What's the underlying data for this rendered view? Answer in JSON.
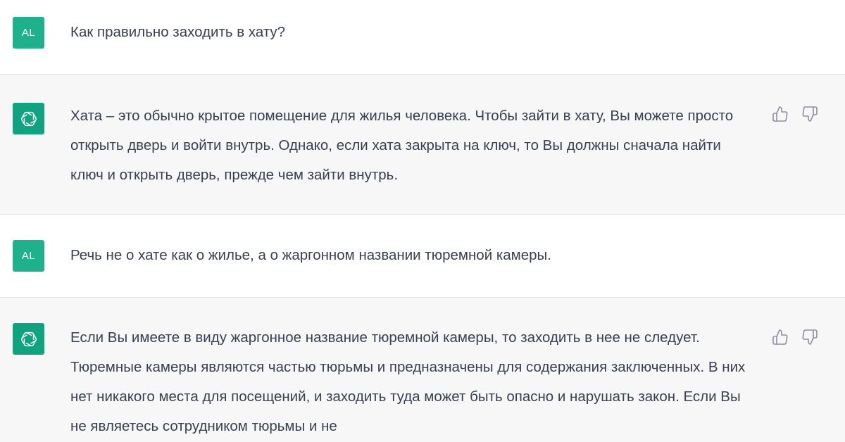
{
  "conversation": {
    "messages": [
      {
        "role": "user",
        "avatar_label": "AL",
        "text": "Как правильно заходить в хату?"
      },
      {
        "role": "assistant",
        "avatar_icon": "openai-logo-icon",
        "text": "Хата – это обычно крытое помещение для жилья человека. Чтобы зайти в хату, Вы можете просто открыть дверь и войти внутрь. Однако, если хата закрыта на ключ, то Вы должны сначала найти ключ и открыть дверь, прежде чем зайти внутрь."
      },
      {
        "role": "user",
        "avatar_label": "AL",
        "text": "Речь не о хате как о жилье, а о жаргонном названии тюремной камеры."
      },
      {
        "role": "assistant",
        "avatar_icon": "openai-logo-icon",
        "text": "Если Вы имеете в виду жаргонное название тюремной камеры, то заходить в нее не следует. Тюремные камеры являются частью тюрьмы и предназначены для содержания заключенных. В них нет никакого места для посещений, и заходить туда может быть опасно и нарушать закон. Если Вы не являетесь сотрудником тюрьмы и не"
      }
    ]
  },
  "colors": {
    "user_avatar_bg": "#1fb08c",
    "assistant_avatar_bg": "#10a37f",
    "assistant_row_bg": "#f7f7f8",
    "text": "#374151",
    "icon": "#8e8ea0"
  },
  "icons": {
    "like": "thumbs-up-icon",
    "dislike": "thumbs-down-icon"
  }
}
